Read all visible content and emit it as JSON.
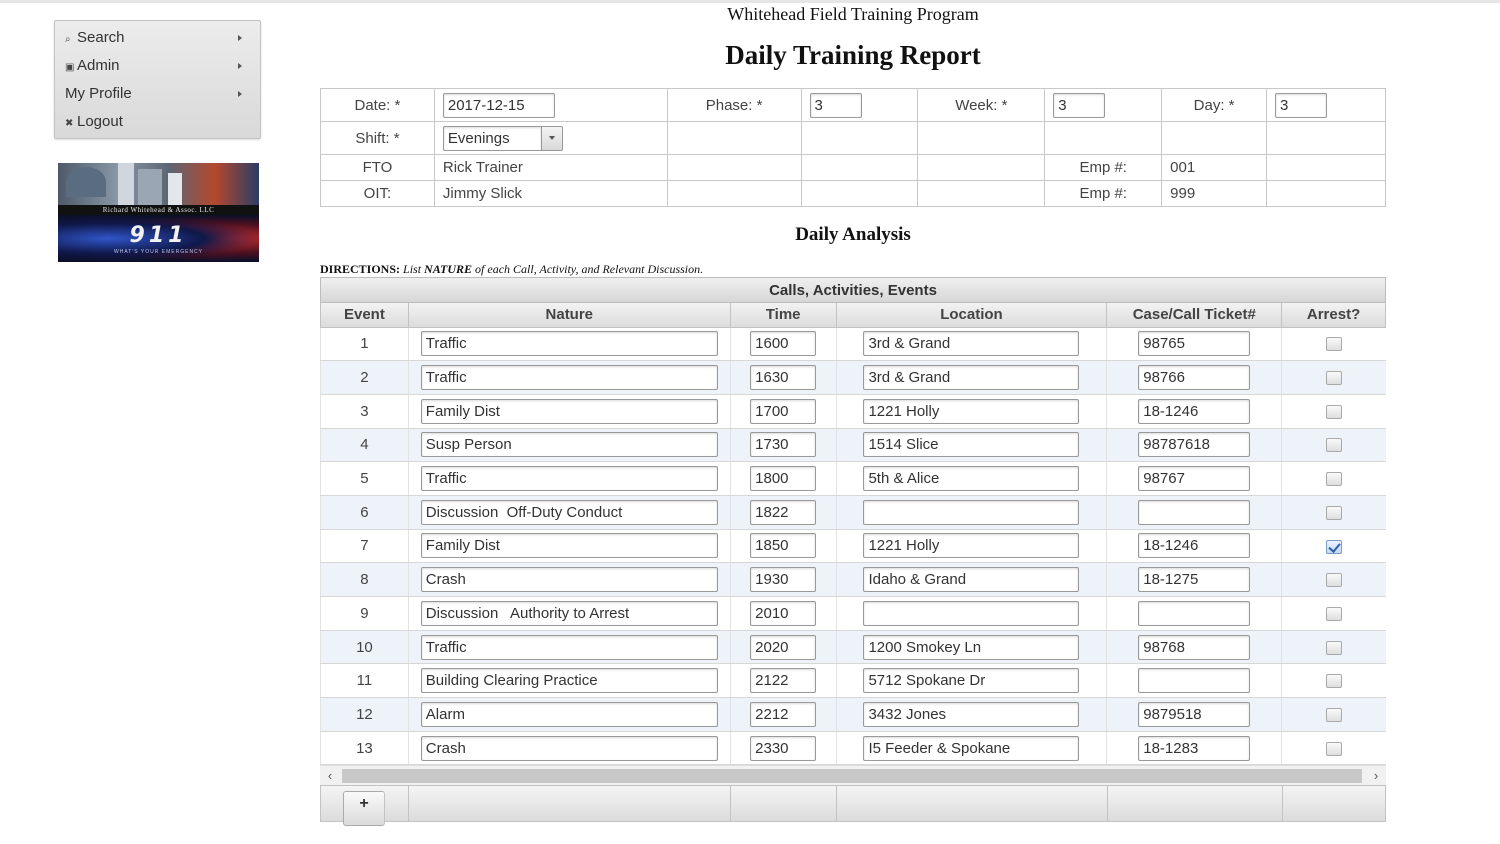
{
  "menu": {
    "items": [
      {
        "icon": "⌕",
        "label": "Search"
      },
      {
        "icon": "▣",
        "label": "Admin"
      },
      {
        "icon": "",
        "label": "My Profile"
      },
      {
        "icon": "✖",
        "label": "Logout"
      }
    ]
  },
  "logo": {
    "company": "Richard Whitehead & Assoc. LLC",
    "number": "911",
    "tagline": "WHAT'S YOUR EMERGENCY"
  },
  "header": {
    "program": "Whitehead Field Training Program",
    "title": "Daily Training Report"
  },
  "info": {
    "date_label": "Date:  *",
    "date_value": "2017-12-15",
    "phase_label": "Phase:  *",
    "phase_value": "3",
    "week_label": "Week:  *",
    "week_value": "3",
    "day_label": "Day:  *",
    "day_value": "3",
    "shift_label": "Shift:  *",
    "shift_value": "Evenings",
    "fto_label": "FTO",
    "fto_name": "Rick Trainer",
    "fto_emp_label": "Emp #:",
    "fto_emp": "001",
    "oit_label": "OIT:",
    "oit_name": "Jimmy Slick",
    "oit_emp_label": "Emp #:",
    "oit_emp": "999"
  },
  "analysis": {
    "title": "Daily Analysis",
    "directions_label": "DIRECTIONS:",
    "directions_pre": "List ",
    "directions_em": "NATURE",
    "directions_post": " of each Call, Activity, and Relevant Discussion."
  },
  "grid": {
    "caption": "Calls, Activities, Events",
    "columns": [
      "Event",
      "Nature",
      "Time",
      "Location",
      "Case/Call Ticket#",
      "Arrest?"
    ],
    "rows": [
      {
        "event": "1",
        "nature": "Traffic",
        "time": "1600",
        "location": "3rd & Grand",
        "case": "98765",
        "arrest": false
      },
      {
        "event": "2",
        "nature": "Traffic",
        "time": "1630",
        "location": "3rd & Grand",
        "case": "98766",
        "arrest": false
      },
      {
        "event": "3",
        "nature": "Family Dist",
        "time": "1700",
        "location": "1221 Holly",
        "case": "18-1246",
        "arrest": false
      },
      {
        "event": "4",
        "nature": "Susp Person",
        "time": "1730",
        "location": "1514 Slice",
        "case": "98787618",
        "arrest": false
      },
      {
        "event": "5",
        "nature": "Traffic",
        "time": "1800",
        "location": "5th & Alice",
        "case": "98767",
        "arrest": false
      },
      {
        "event": "6",
        "nature": "Discussion  Off-Duty Conduct",
        "time": "1822",
        "location": "",
        "case": "",
        "arrest": false
      },
      {
        "event": "7",
        "nature": "Family Dist",
        "time": "1850",
        "location": "1221 Holly",
        "case": "18-1246",
        "arrest": true
      },
      {
        "event": "8",
        "nature": "Crash",
        "time": "1930",
        "location": "Idaho & Grand",
        "case": "18-1275",
        "arrest": false
      },
      {
        "event": "9",
        "nature": "Discussion   Authority to Arrest",
        "time": "2010",
        "location": "",
        "case": "",
        "arrest": false
      },
      {
        "event": "10",
        "nature": "Traffic",
        "time": "2020",
        "location": "1200 Smokey Ln",
        "case": "98768",
        "arrest": false
      },
      {
        "event": "11",
        "nature": "Building Clearing Practice",
        "time": "2122",
        "location": "5712 Spokane Dr",
        "case": "",
        "arrest": false
      },
      {
        "event": "12",
        "nature": "Alarm",
        "time": "2212",
        "location": "3432 Jones",
        "case": "9879518",
        "arrest": false
      },
      {
        "event": "13",
        "nature": "Crash",
        "time": "2330",
        "location": "I5 Feeder & Spokane",
        "case": "18-1283",
        "arrest": false
      }
    ],
    "scroll_left": "‹",
    "scroll_right": "›",
    "add_label": "+"
  }
}
